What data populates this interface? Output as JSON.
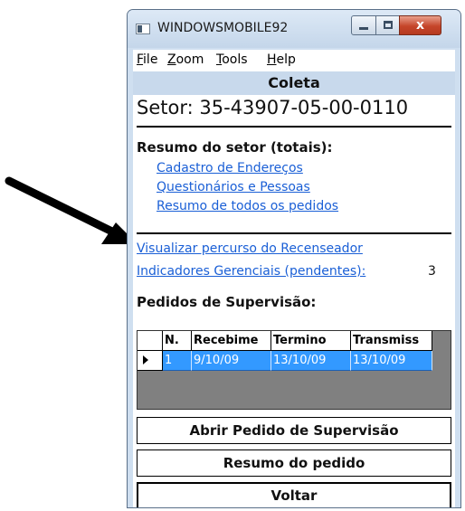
{
  "window": {
    "title": "WINDOWSMOBILE92",
    "close_glyph": "x"
  },
  "menu": {
    "items": [
      {
        "accel": "F",
        "rest": "ile"
      },
      {
        "accel": "Z",
        "rest": "oom"
      },
      {
        "accel": "T",
        "rest": "ools"
      },
      {
        "accel": "H",
        "rest": "elp"
      }
    ]
  },
  "header": {
    "title": "Coleta",
    "setor": "Setor: 35-43907-05-00-0110"
  },
  "resumo": {
    "title": "Resumo do setor (totais):",
    "links": [
      "Cadastro de Endereços",
      "Questionários e Pessoas",
      "Resumo de todos os pedidos"
    ]
  },
  "actions": {
    "visualizar": "Visualizar percurso do Recenseador",
    "indicadores": "Indicadores Gerenciais (pendentes):",
    "indicadores_count": "3"
  },
  "pedidos": {
    "title": "Pedidos de Supervisão:",
    "columns": [
      "N.",
      "Recebime",
      "Termino",
      "Transmiss"
    ],
    "rows": [
      [
        "1",
        "9/10/09",
        "13/10/09",
        "13/10/09"
      ]
    ]
  },
  "buttons": {
    "abrir": "Abrir Pedido de Supervisão",
    "resumo": "Resumo do pedido",
    "voltar": "Voltar"
  },
  "colors": {
    "link": "#1a5fd6",
    "selected_row": "#3399ff",
    "header_band": "#c8d9ec"
  }
}
